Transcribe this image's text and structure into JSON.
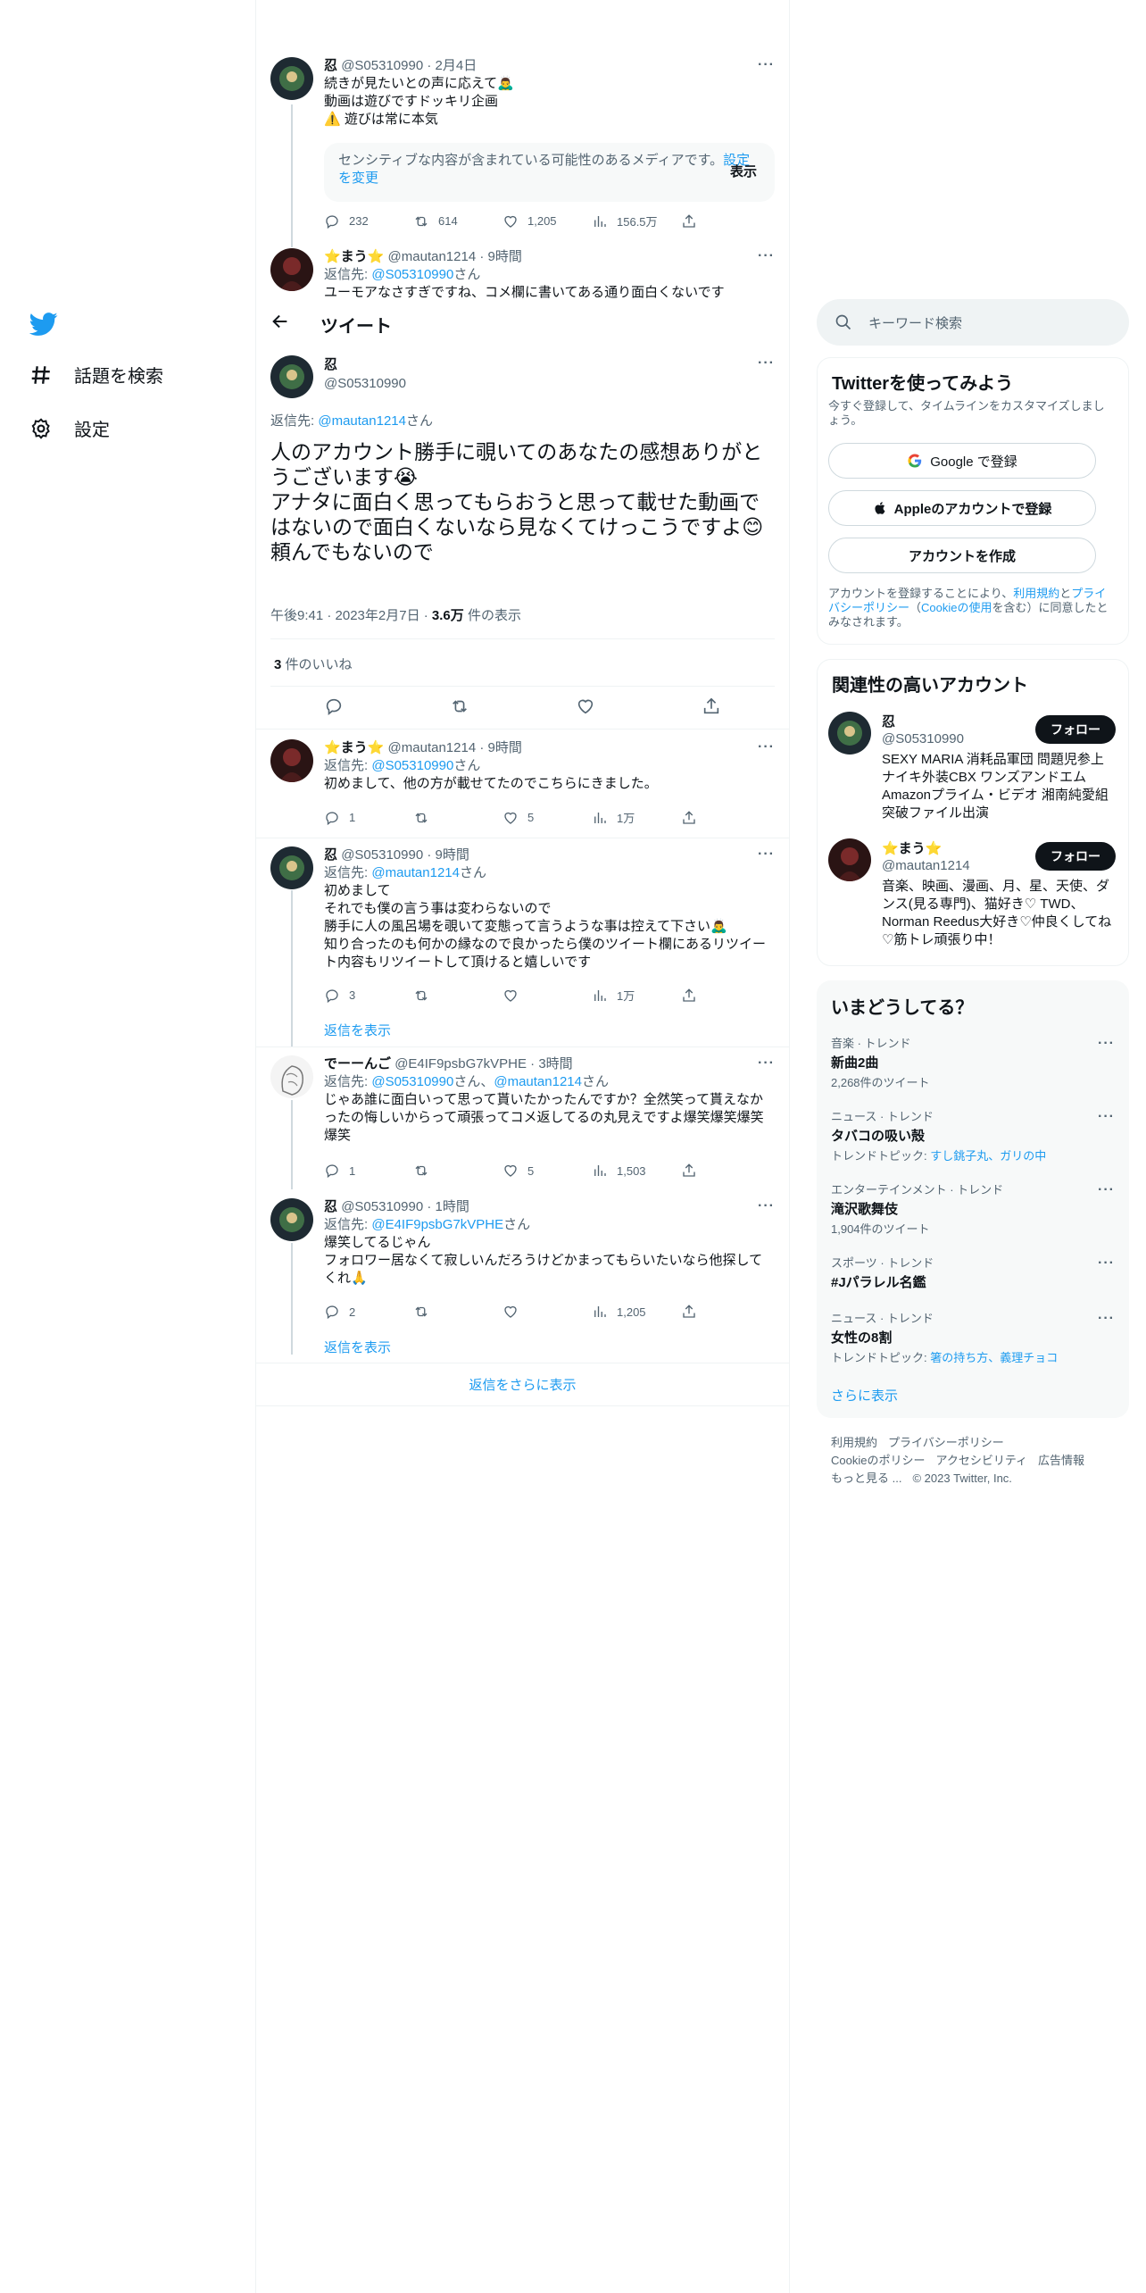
{
  "nav": {
    "explore": "話題を検索",
    "settings": "設定"
  },
  "header": {
    "title": "ツイート"
  },
  "prev_tweet": {
    "name": "忍",
    "handle": "@S05310990",
    "time": "2月4日",
    "text": "続きが見たいとの声に応えて🙇‍♂️\n動画は遊びですドッキリ企画\n⚠️ 遊びは常に本気",
    "sensitive_text": "センシティブな内容が含まれている可能性のあるメディアです。",
    "sensitive_link": "設定を変更",
    "sensitive_show": "表示",
    "replies": "232",
    "retweets": "614",
    "likes": "1,205",
    "views": "156.5万"
  },
  "parent_tweet": {
    "name": "⭐まう⭐",
    "handle": "@mautan1214",
    "time": "9時間",
    "reply_prefix": "返信先: ",
    "reply_to": "@S05310990",
    "reply_suffix": "さん",
    "text": "ユーモアなさすぎですね、コメ欄に書いてある通り面白くないです"
  },
  "main_tweet": {
    "name": "忍",
    "handle": "@S05310990",
    "reply_prefix": "返信先: ",
    "reply_to": "@mautan1214",
    "reply_suffix": "さん",
    "text": "人のアカウント勝手に覗いてのあなたの感想ありがとうございます😭\nアナタに面白く思ってもらおうと思って載せた動画ではないので面白くないなら見なくてけっこうですよ😊\n頼んでもないので",
    "time": "午後9:41 · 2023年2月7日 · ",
    "views_count": "3.6万",
    "views_label": " 件の表示",
    "likes_count": "3",
    "likes_label": " 件のいいね"
  },
  "replies": [
    {
      "name": "⭐まう⭐",
      "handle": "@mautan1214",
      "time": "9時間",
      "reply_prefix": "返信先: ",
      "reply_to": "@S05310990",
      "reply_suffix": "さん",
      "text": "初めまして、他の方が載せてたのでこちらにきました。",
      "replies": "1",
      "retweets": "",
      "likes": "5",
      "views": "1万"
    },
    {
      "name": "忍",
      "handle": "@S05310990",
      "time": "9時間",
      "reply_prefix": "返信先: ",
      "reply_to": "@mautan1214",
      "reply_suffix": "さん",
      "text": "初めまして\nそれでも僕の言う事は変わらないので\n勝手に人の風呂場を覗いて変態って言うような事は控えて下さい🙇‍♂️\n知り合ったのも何かの縁なので良かったら僕のツイート欄にあるリツイート内容もリツイートして頂けると嬉しいです",
      "replies": "3",
      "retweets": "",
      "likes": "",
      "views": "1万",
      "show_replies": "返信を表示"
    },
    {
      "name": "でーーんご",
      "handle": "@E4IF9psbG7kVPHE",
      "time": "3時間",
      "reply_prefix": "返信先: ",
      "reply_to": "@S05310990",
      "reply_mid": "さん、",
      "reply_to2": "@mautan1214",
      "reply_suffix": "さん",
      "text": "じゃあ誰に面白いって思って貰いたかったんですか？全然笑って貰えなかったの悔しいからって頑張ってコメ返してるの丸見えですよ爆笑爆笑爆笑爆笑",
      "replies": "1",
      "retweets": "",
      "likes": "5",
      "views": "1,503"
    },
    {
      "name": "忍",
      "handle": "@S05310990",
      "time": "1時間",
      "reply_prefix": "返信先: ",
      "reply_to": "@E4IF9psbG7kVPHE",
      "reply_suffix": "さん",
      "text": "爆笑してるじゃん\nフォロワー居なくて寂しいんだろうけどかまってもらいたいなら他探してくれ🙏",
      "replies": "2",
      "retweets": "",
      "likes": "",
      "views": "1,205",
      "show_replies": "返信を表示"
    }
  ],
  "show_more_replies": "返信をさらに表示",
  "search": {
    "placeholder": "キーワード検索"
  },
  "signup": {
    "title": "Twitterを使ってみよう",
    "desc": "今すぐ登録して、タイムラインをカスタマイズしましょう。",
    "google": "Google で登録",
    "apple": "Appleのアカウントで登録",
    "create": "アカウントを作成",
    "legal_1": "アカウントを登録することにより、",
    "legal_terms": "利用規約",
    "legal_2": "と",
    "legal_privacy": "プライバシーポリシー",
    "legal_3": "（",
    "legal_cookie": "Cookieの使用",
    "legal_4": "を含む）に同意したとみなされます。"
  },
  "related": {
    "title": "関連性の高いアカウント",
    "accounts": [
      {
        "name": "忍",
        "handle": "@S05310990",
        "follow": "フォロー",
        "bio": "SEXY MARIA 消耗品軍団 問題児参上 ナイキ外装CBX ワンズアンドエム Amazonプライム・ビデオ 湘南純愛組 突破ファイル出演"
      },
      {
        "name": "⭐まう⭐",
        "handle": "@mautan1214",
        "follow": "フォロー",
        "bio": "音楽、映画、漫画、月、星、天使、ダンス(見る専門)、猫好き♡ TWD、Norman Reedus大好き♡仲良くしてね♡筋トレ頑張り中！"
      }
    ]
  },
  "trends": {
    "title": "いまどうしてる？",
    "items": [
      {
        "category": "音楽 · トレンド",
        "name": "新曲2曲",
        "sub": "2,268件のツイート"
      },
      {
        "category": "ニュース · トレンド",
        "name": "タバコの吸い殻",
        "sub_prefix": "トレンドトピック: ",
        "sub_link": "すし銚子丸、ガリの中"
      },
      {
        "category": "エンターテインメント · トレンド",
        "name": "滝沢歌舞伎",
        "sub": "1,904件のツイート"
      },
      {
        "category": "スポーツ · トレンド",
        "name": "#Jパラレル名鑑",
        "sub": ""
      },
      {
        "category": "ニュース · トレンド",
        "name": "女性の8割",
        "sub_prefix": "トレンドトピック: ",
        "sub_link": "箸の持ち方、義理チョコ"
      }
    ],
    "show_more": "さらに表示"
  },
  "footer": {
    "terms": "利用規約",
    "privacy": "プライバシーポリシー",
    "cookie": "Cookieのポリシー",
    "accessibility": "アクセシビリティ",
    "ads": "広告情報",
    "more": "もっと見る ...",
    "copyright": "© 2023 Twitter, Inc."
  },
  "colors": {
    "accent": "#1d9bf0",
    "text": "#0f1419",
    "muted": "#536471",
    "border": "#eff3f4"
  }
}
